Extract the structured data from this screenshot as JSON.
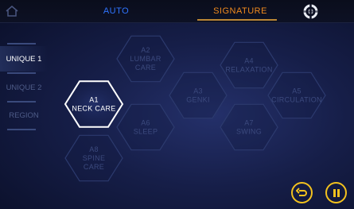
{
  "topbar": {
    "home_icon": "home-icon",
    "tabs": [
      {
        "label": "AUTO",
        "color": "#2f74ff"
      },
      {
        "label": "SIGNATURE",
        "color": "#f08a1e"
      }
    ],
    "settings_icon": "settings-icon"
  },
  "sidebar": {
    "items": [
      {
        "label": "UNIQUE 1",
        "active": true
      },
      {
        "label": "UNIQUE 2",
        "active": false
      },
      {
        "label": "REGION",
        "active": false
      }
    ]
  },
  "programs": [
    {
      "code": "A1",
      "lines": [
        "NECK CARE"
      ],
      "selected": true
    },
    {
      "code": "A2",
      "lines": [
        "LUMBAR",
        "CARE"
      ],
      "selected": false
    },
    {
      "code": "A3",
      "lines": [
        "GENKI"
      ],
      "selected": false
    },
    {
      "code": "A4",
      "lines": [
        "RELAXATION"
      ],
      "selected": false
    },
    {
      "code": "A5",
      "lines": [
        "CIRCULATION"
      ],
      "selected": false
    },
    {
      "code": "A6",
      "lines": [
        "SLEEP"
      ],
      "selected": false
    },
    {
      "code": "A7",
      "lines": [
        "SWING"
      ],
      "selected": false
    },
    {
      "code": "A8",
      "lines": [
        "SPINE",
        "CARE"
      ],
      "selected": false
    }
  ],
  "controls": {
    "back_icon": "undo-icon",
    "pause_icon": "pause-icon",
    "accent_color": "#f3c21e"
  }
}
